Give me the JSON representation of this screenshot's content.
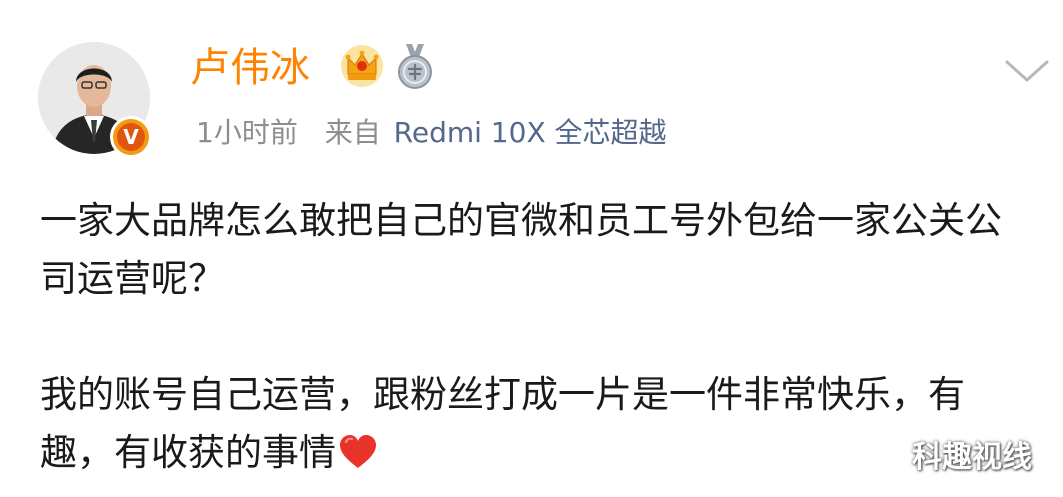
{
  "post": {
    "author": {
      "name": "卢伟冰",
      "avatar_icon": "user-avatar-photo",
      "verified_icon": "verified-v-icon",
      "verified_letter": "V",
      "crown_icon": "vip-crown-icon",
      "medal_icon": "answer-medal-icon",
      "accent_color": "#ff8200"
    },
    "meta": {
      "time": "1小时前",
      "from_label": "来自",
      "device": "Redmi 10X 全芯超越"
    },
    "menu_icon": "chevron-down-icon",
    "content": {
      "paragraph_1": "一家大品牌怎么敢把自己的官微和员工号外包给一家公关公司运营呢？",
      "paragraph_2": "我的账号自己运营，跟粉丝打成一片是一件非常快乐，有趣，有收获的事情",
      "emoji_icon": "red-heart-icon"
    }
  },
  "watermark": "科趣视线"
}
